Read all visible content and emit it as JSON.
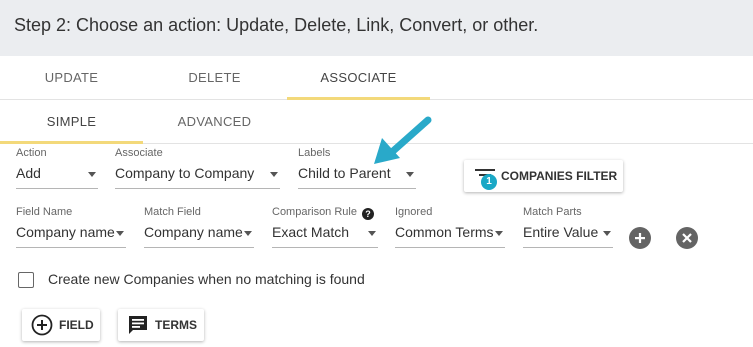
{
  "header": {
    "title": "Step 2: Choose an action: Update, Delete, Link, Convert, or other."
  },
  "main_tabs": [
    {
      "label": "UPDATE",
      "active": false
    },
    {
      "label": "DELETE",
      "active": false
    },
    {
      "label": "ASSOCIATE",
      "active": true
    }
  ],
  "sub_tabs": [
    {
      "label": "SIMPLE",
      "active": true
    },
    {
      "label": "ADVANCED",
      "active": false
    }
  ],
  "row1": {
    "action": {
      "label": "Action",
      "value": "Add"
    },
    "associate": {
      "label": "Associate",
      "value": "Company to Company"
    },
    "labels": {
      "label": "Labels",
      "value": "Child to Parent"
    },
    "filter_button": {
      "label": "COMPANIES FILTER",
      "badge": "1",
      "icon": "filter-icon"
    }
  },
  "row2": {
    "field_name": {
      "label": "Field Name",
      "value": "Company name"
    },
    "match_field": {
      "label": "Match Field",
      "value": "Company name"
    },
    "comparison_rule": {
      "label": "Comparison Rule",
      "value": "Exact Match",
      "help_icon": "?"
    },
    "ignored": {
      "label": "Ignored",
      "value": "Common Terms"
    },
    "match_parts": {
      "label": "Match Parts",
      "value": "Entire Value"
    },
    "add_icon": "plus-circle-icon",
    "remove_icon": "close-circle-icon"
  },
  "checkbox": {
    "label": "Create new Companies when no matching is found",
    "checked": false
  },
  "buttons": {
    "field": {
      "label": "FIELD",
      "icon": "plus-circle-outline-icon"
    },
    "terms": {
      "label": "TERMS",
      "icon": "comment-icon"
    }
  },
  "colors": {
    "accent_underline": "#f3d97a",
    "arrow": "#29a9c9",
    "badge": "#1aa8c6",
    "header_bg": "#ebedf0"
  }
}
